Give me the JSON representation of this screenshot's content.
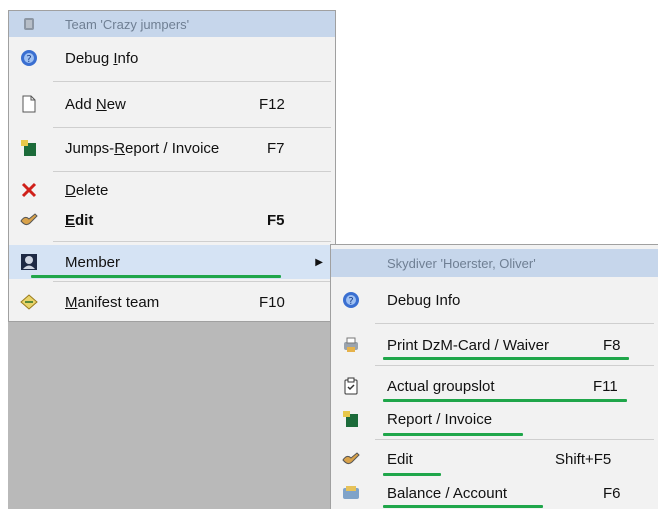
{
  "team_menu": {
    "header": "Team 'Crazy jumpers'",
    "items": [
      {
        "label": "Debug Info",
        "mnemonic": "I",
        "shortcut": "",
        "icon": "info-globe-icon"
      },
      {
        "label": "Add New",
        "mnemonic": "N",
        "shortcut": "F12",
        "icon": "new-document-icon"
      },
      {
        "label": "Jumps-Report / Invoice",
        "mnemonic": "R",
        "shortcut": "F7",
        "icon": "report-icon"
      },
      {
        "label": "Delete",
        "mnemonic": "D",
        "shortcut": "",
        "icon": "delete-x-icon"
      },
      {
        "label": "Edit",
        "mnemonic": "E",
        "shortcut": "F5",
        "icon": "edit-hand-icon"
      },
      {
        "label": "Member",
        "mnemonic": "",
        "shortcut": "",
        "icon": "member-icon",
        "submenu": true
      },
      {
        "label": "Manifest team",
        "mnemonic": "M",
        "shortcut": "F10",
        "icon": "manifest-ticket-icon"
      }
    ]
  },
  "member_menu": {
    "header": "Skydiver 'Hoerster, Oliver'",
    "items": [
      {
        "label": "Debug Info",
        "shortcut": "",
        "icon": "info-globe-icon"
      },
      {
        "label": "Print DzM-Card / Waiver",
        "shortcut": "F8",
        "icon": "printer-icon"
      },
      {
        "label": "Actual groupslot",
        "shortcut": "F11",
        "icon": "clipboard-check-icon"
      },
      {
        "label": "Report / Invoice",
        "shortcut": "",
        "icon": "report-icon"
      },
      {
        "label": "Edit",
        "shortcut": "Shift+F5",
        "icon": "edit-hand-icon"
      },
      {
        "label": "Balance / Account",
        "shortcut": "F6",
        "icon": "balance-card-icon"
      }
    ]
  },
  "colors": {
    "highlight_underline": "#1fa64a",
    "header_bg": "#c6d6eb",
    "menu_bg": "#f2f2f2"
  }
}
